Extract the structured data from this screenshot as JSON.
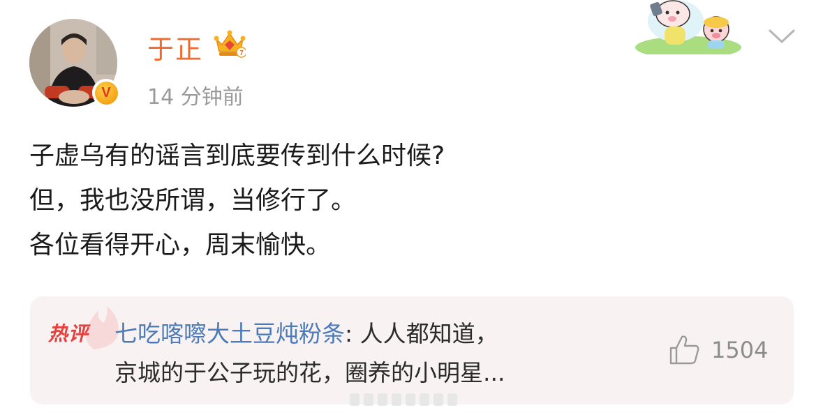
{
  "author": {
    "name": "于正",
    "timestamp": "14 分钟前",
    "verified": true,
    "avatar_icon": "portrait-avatar",
    "vip_icon": "crown-icon"
  },
  "header": {
    "decoration_icon": "cartoon-sticker",
    "menu_icon": "chevron-down-icon"
  },
  "post": {
    "lines": [
      "子虚乌有的谣言到底要传到什么时候?",
      "但，我也没所谓，当修行了。",
      "各位看得开心，周末愉快。"
    ]
  },
  "hot_comment": {
    "badge_label": "热评",
    "user": "七吃喀嚓大土豆炖粉条",
    "separator": ": ",
    "text_line1": "人人都知道，",
    "text_line2": "京城的于公子玩的花，圈养的小明星...",
    "likes": "1504"
  },
  "colors": {
    "username": "#f0692e",
    "timestamp": "#9a9a9a",
    "comment_user": "#4c7bb8",
    "hot_badge": "#e7403c",
    "comment_bg": "#f9f2f2"
  }
}
